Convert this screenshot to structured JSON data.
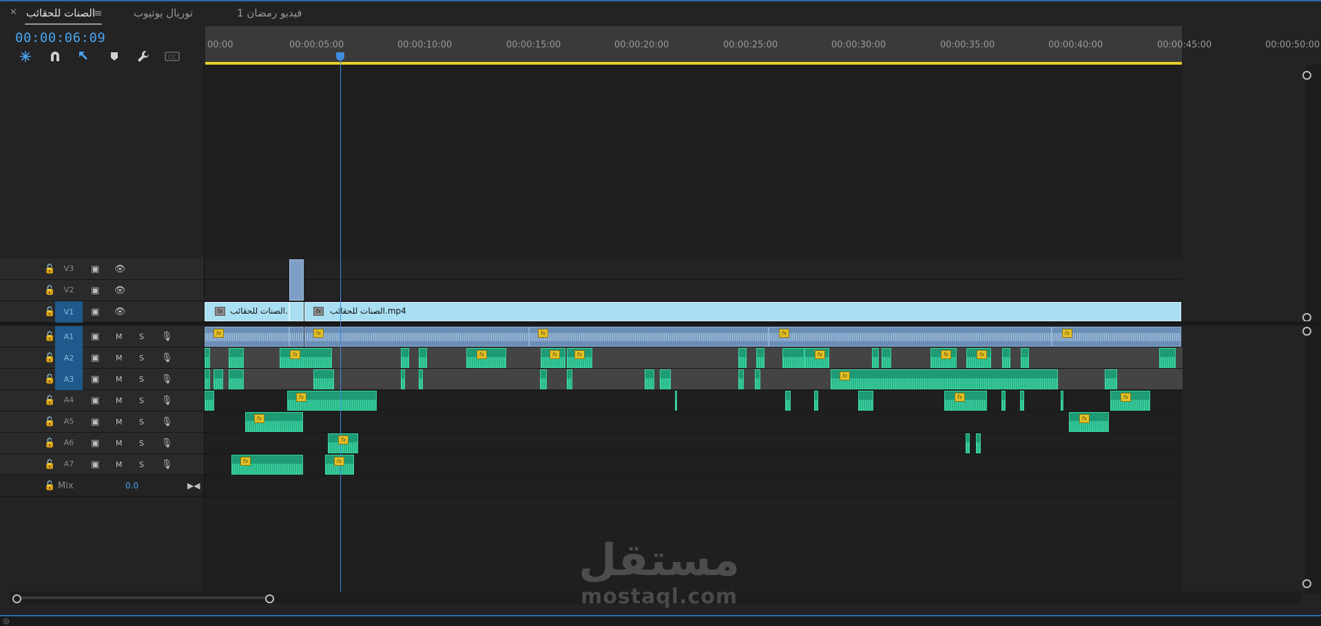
{
  "tabs": [
    {
      "label": "الصنات للحقائب",
      "active": true
    },
    {
      "label": "توريال يوتيوب",
      "active": false
    },
    {
      "label": "فيديو رمضان 1",
      "active": false
    }
  ],
  "tab_close_glyph": "×",
  "tab_menu_glyph": "≡",
  "timecode": "00:00:06:09",
  "tools": [
    {
      "name": "nest-icon"
    },
    {
      "name": "snap-icon"
    },
    {
      "name": "linked-selection-icon"
    },
    {
      "name": "add-marker-icon"
    },
    {
      "name": "settings-wrench-icon"
    },
    {
      "name": "captions-icon"
    }
  ],
  "ruler": {
    "ticks": [
      "00:00",
      "00:00:05:00",
      "00:00:10:00",
      "00:00:15:00",
      "00:00:20:00",
      "00:00:25:00",
      "00:00:30:00",
      "00:00:35:00",
      "00:00:40:00",
      "00:00:45:00",
      "00:00:50:00"
    ],
    "playhead_timecode": "00:00:06:09"
  },
  "tracks": {
    "video": [
      {
        "label": "V3",
        "targeted": false
      },
      {
        "label": "V2",
        "targeted": false
      },
      {
        "label": "V1",
        "targeted": true
      }
    ],
    "audio": [
      {
        "label": "A1",
        "targeted": true,
        "m": "M",
        "s": "S"
      },
      {
        "label": "A2",
        "targeted": true,
        "m": "M",
        "s": "S"
      },
      {
        "label": "A3",
        "targeted": true,
        "m": "M",
        "s": "S"
      },
      {
        "label": "A4",
        "targeted": false,
        "m": "M",
        "s": "S"
      },
      {
        "label": "A5",
        "targeted": false,
        "m": "M",
        "s": "S"
      },
      {
        "label": "A6",
        "targeted": false,
        "m": "M",
        "s": "S"
      },
      {
        "label": "A7",
        "targeted": false,
        "m": "M",
        "s": "S"
      }
    ],
    "mix": {
      "label": "Mix",
      "value": "0.0"
    }
  },
  "clips": {
    "v1_first": "الصنات للحقائب.",
    "v1_second": "الصنات للحقائب.mp4",
    "fx_label": "fx"
  },
  "watermark": {
    "arabic": "مستقل",
    "latin": "mostaql.com"
  },
  "colors": {
    "accent": "#3f8ee0",
    "video_clip": "#a9dff3",
    "audio_clip": "#1e9a74",
    "work_area": "#e8d02c"
  }
}
